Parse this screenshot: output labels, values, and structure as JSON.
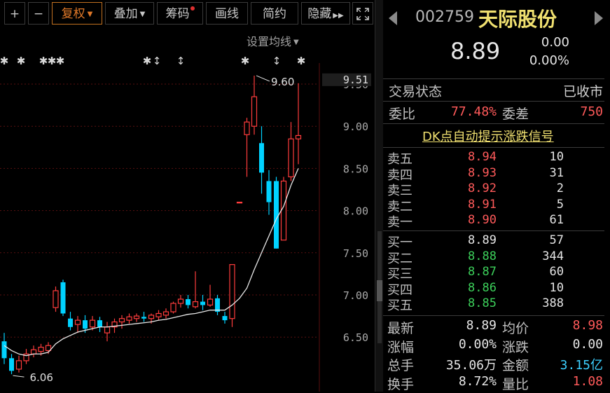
{
  "toolbar": {
    "plus": "+",
    "minus": "−",
    "fuquan": "复权",
    "diejia": "叠加",
    "chouma": "筹码",
    "huaxian": "画线",
    "jianyue": "简约",
    "yincang": "隐藏",
    "more_icon": "double-chevron-right-icon",
    "fullscreen_icon": "fullscreen-icon"
  },
  "setting_ma": "设置均线",
  "chart_data": {
    "type": "candlestick",
    "y_ticks": [
      "9.50",
      "9.00",
      "8.50",
      "8.00",
      "7.50",
      "7.00",
      "6.50"
    ],
    "current_price_label": "9.51",
    "high_annotation": "9.60",
    "low_annotation": "6.06",
    "markers": [
      "star",
      "star",
      "star",
      "star",
      "star",
      "star",
      "arrow",
      "arrow",
      "star",
      "arrow",
      "star"
    ],
    "colors": {
      "up": "#ff3c3c",
      "down": "#00d2ff",
      "ma": "#e8e8e8",
      "grid": "#5a1010"
    },
    "candles": [
      {
        "o": 6.45,
        "c": 6.25,
        "h": 6.55,
        "l": 6.18
      },
      {
        "o": 6.25,
        "c": 6.1,
        "h": 6.3,
        "l": 6.06
      },
      {
        "o": 6.12,
        "c": 6.22,
        "h": 6.28,
        "l": 6.08
      },
      {
        "o": 6.22,
        "c": 6.3,
        "h": 6.36,
        "l": 6.18
      },
      {
        "o": 6.3,
        "c": 6.35,
        "h": 6.4,
        "l": 6.26
      },
      {
        "o": 6.33,
        "c": 6.38,
        "h": 6.42,
        "l": 6.28
      },
      {
        "o": 6.34,
        "c": 6.4,
        "h": 6.44,
        "l": 6.3
      },
      {
        "o": 6.85,
        "c": 7.05,
        "h": 7.1,
        "l": 6.8
      },
      {
        "o": 7.15,
        "c": 6.78,
        "h": 7.18,
        "l": 6.75
      },
      {
        "o": 6.72,
        "c": 6.62,
        "h": 6.8,
        "l": 6.58
      },
      {
        "o": 6.65,
        "c": 6.7,
        "h": 6.75,
        "l": 6.55
      },
      {
        "o": 6.7,
        "c": 6.6,
        "h": 6.76,
        "l": 6.55
      },
      {
        "o": 6.62,
        "c": 6.7,
        "h": 6.75,
        "l": 6.58
      },
      {
        "o": 6.7,
        "c": 6.62,
        "h": 6.74,
        "l": 6.56
      },
      {
        "o": 6.55,
        "c": 6.62,
        "h": 6.68,
        "l": 6.45
      },
      {
        "o": 6.62,
        "c": 6.68,
        "h": 6.72,
        "l": 6.55
      },
      {
        "o": 6.68,
        "c": 6.72,
        "h": 6.76,
        "l": 6.6
      },
      {
        "o": 6.7,
        "c": 6.74,
        "h": 6.78,
        "l": 6.66
      },
      {
        "o": 6.72,
        "c": 6.75,
        "h": 6.78,
        "l": 6.68
      },
      {
        "o": 6.74,
        "c": 6.72,
        "h": 6.8,
        "l": 6.68
      },
      {
        "o": 6.72,
        "c": 6.76,
        "h": 6.78,
        "l": 6.66
      },
      {
        "o": 6.74,
        "c": 6.78,
        "h": 6.82,
        "l": 6.7
      },
      {
        "o": 6.76,
        "c": 6.8,
        "h": 6.84,
        "l": 6.72
      },
      {
        "o": 6.8,
        "c": 6.9,
        "h": 6.92,
        "l": 6.78
      },
      {
        "o": 6.9,
        "c": 6.95,
        "h": 7.0,
        "l": 6.85
      },
      {
        "o": 6.95,
        "c": 6.88,
        "h": 7.0,
        "l": 6.84
      },
      {
        "o": 6.86,
        "c": 6.92,
        "h": 7.28,
        "l": 6.84
      },
      {
        "o": 6.92,
        "c": 6.88,
        "h": 7.0,
        "l": 6.82
      },
      {
        "o": 6.88,
        "c": 6.95,
        "h": 7.12,
        "l": 6.86
      },
      {
        "o": 6.96,
        "c": 6.8,
        "h": 7.0,
        "l": 6.76
      },
      {
        "o": 6.75,
        "c": 6.7,
        "h": 6.8,
        "l": 6.66
      },
      {
        "o": 6.72,
        "c": 7.36,
        "h": 7.36,
        "l": 6.62
      },
      {
        "o": 8.1,
        "c": 8.1,
        "h": 8.1,
        "l": 8.1
      },
      {
        "o": 8.9,
        "c": 9.05,
        "h": 9.1,
        "l": 8.4
      },
      {
        "o": 9.0,
        "c": 9.35,
        "h": 9.6,
        "l": 8.9
      },
      {
        "o": 8.8,
        "c": 8.45,
        "h": 9.0,
        "l": 8.2
      },
      {
        "o": 8.35,
        "c": 8.1,
        "h": 8.48,
        "l": 7.95
      },
      {
        "o": 8.35,
        "c": 7.55,
        "h": 8.4,
        "l": 7.55
      },
      {
        "o": 7.65,
        "c": 8.35,
        "h": 8.4,
        "l": 7.65
      },
      {
        "o": 8.4,
        "c": 8.85,
        "h": 9.05,
        "l": 8.35
      },
      {
        "o": 8.85,
        "c": 8.89,
        "h": 9.51,
        "l": 8.55
      }
    ],
    "ma": [
      6.4,
      6.34,
      6.3,
      6.28,
      6.3,
      6.3,
      6.32,
      6.42,
      6.48,
      6.52,
      6.56,
      6.58,
      6.6,
      6.62,
      6.62,
      6.63,
      6.64,
      6.65,
      6.66,
      6.67,
      6.68,
      6.7,
      6.71,
      6.73,
      6.75,
      6.77,
      6.78,
      6.8,
      6.82,
      6.82,
      6.82,
      6.88,
      6.96,
      7.08,
      7.3,
      7.5,
      7.7,
      7.9,
      8.05,
      8.3,
      8.5
    ]
  },
  "stock": {
    "code": "002759",
    "name": "天际股份",
    "price": "8.89",
    "change": "0.00",
    "change_pct": "0.00%"
  },
  "status": {
    "label": "交易状态",
    "value": "已收市"
  },
  "ratio": {
    "label": "委比",
    "value": "77.48%",
    "diff_label": "委差",
    "diff_value": "750"
  },
  "dk_link": "DK点自动提示涨跌信号",
  "asks": [
    {
      "label": "卖五",
      "price": "8.94",
      "vol": "10"
    },
    {
      "label": "卖四",
      "price": "8.93",
      "vol": "31"
    },
    {
      "label": "卖三",
      "price": "8.92",
      "vol": "2"
    },
    {
      "label": "卖二",
      "price": "8.91",
      "vol": "5"
    },
    {
      "label": "卖一",
      "price": "8.90",
      "vol": "61"
    }
  ],
  "bids": [
    {
      "label": "买一",
      "price": "8.89",
      "vol": "57"
    },
    {
      "label": "买二",
      "price": "8.88",
      "vol": "344"
    },
    {
      "label": "买三",
      "price": "8.87",
      "vol": "60"
    },
    {
      "label": "买四",
      "price": "8.86",
      "vol": "10"
    },
    {
      "label": "买五",
      "price": "8.85",
      "vol": "388"
    }
  ],
  "stats": [
    {
      "l1": "最新",
      "v1": "8.89",
      "l2": "均价",
      "v2": "8.98"
    },
    {
      "l1": "涨幅",
      "v1": "0.00%",
      "l2": "涨跌",
      "v2": "0.00"
    },
    {
      "l1": "总手",
      "v1": "35.06万",
      "l2": "金额",
      "v2": "3.15亿"
    },
    {
      "l1": "换手",
      "v1": "8.72%",
      "l2": "量比",
      "v2": "1.08"
    }
  ]
}
